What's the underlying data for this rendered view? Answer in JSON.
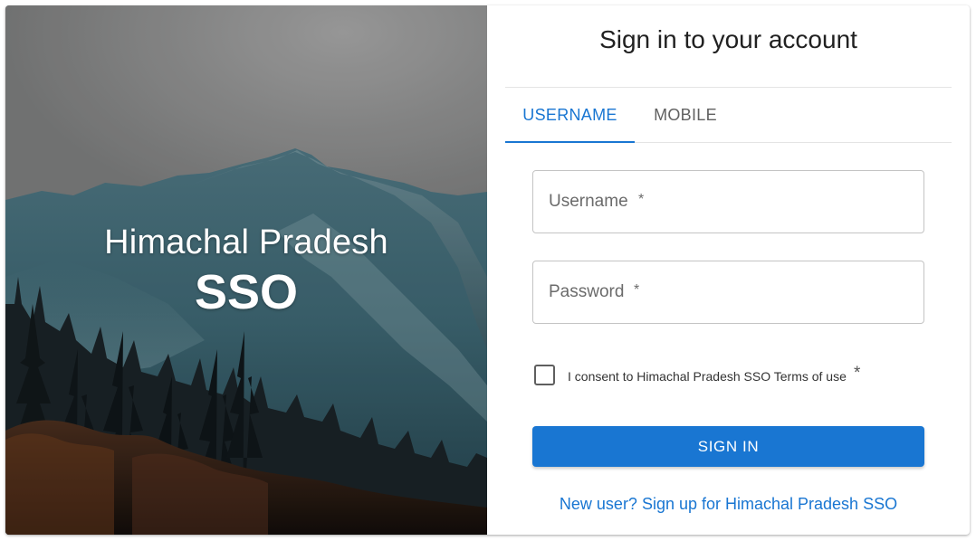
{
  "hero": {
    "title_line1": "Himachal Pradesh",
    "title_line2": "SSO"
  },
  "form": {
    "title": "Sign in to your account",
    "tabs": [
      {
        "label": "USERNAME",
        "active": true
      },
      {
        "label": "MOBILE",
        "active": false
      }
    ],
    "username_placeholder": "Username",
    "password_placeholder": "Password",
    "required_marker": "*",
    "consent_label": "I consent to Himachal Pradesh SSO Terms of use",
    "consent_checked": false,
    "signin_label": "SIGN IN",
    "signup_link": "New user? Sign up for Himachal Pradesh SSO"
  },
  "colors": {
    "accent": "#1976d2",
    "text": "#212121",
    "muted": "#616161"
  }
}
